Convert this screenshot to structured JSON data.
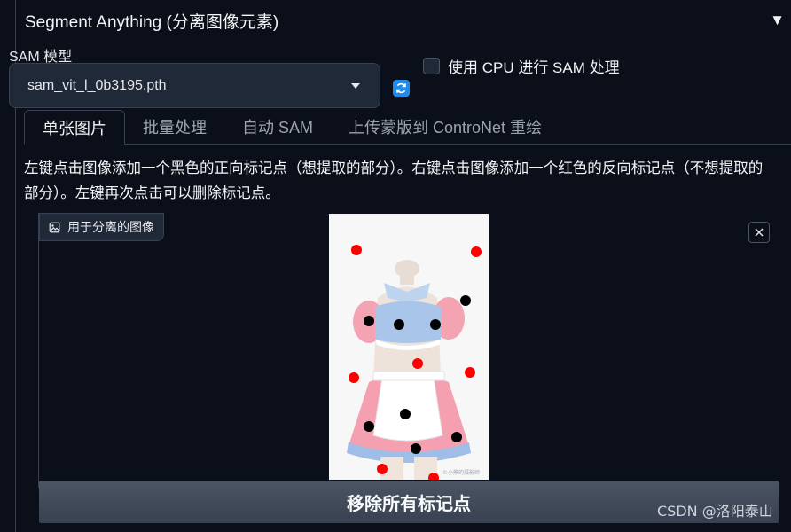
{
  "accordion": {
    "title": "Segment Anything (分离图像元素)",
    "arrow": "▼"
  },
  "sam_model": {
    "label": "SAM 模型",
    "selected": "sam_vit_l_0b3195.pth",
    "refresh_icon": "refresh-icon"
  },
  "cpu_checkbox": {
    "label": "使用 CPU 进行 SAM 处理",
    "checked": false
  },
  "tabs": [
    {
      "label": "单张图片",
      "active": true
    },
    {
      "label": "批量处理",
      "active": false
    },
    {
      "label": "自动 SAM",
      "active": false
    },
    {
      "label": "上传蒙版到 ControNet 重绘",
      "active": false
    }
  ],
  "instructions": "左键点击图像添加一个黑色的正向标记点（想提取的部分）。右键点击图像添加一个红色的反向标记点（不想提取的部分）。左键再次点击可以删除标记点。",
  "image_input": {
    "label": "用于分离的图像",
    "image_icon": "image-icon",
    "close_icon": "close-icon",
    "photo_caption": "©小熊的摄影师",
    "positive_color": "#000000",
    "negative_color": "#ff0000"
  },
  "remove_button": "移除所有标记点",
  "watermark": "CSDN @洛阳泰山"
}
